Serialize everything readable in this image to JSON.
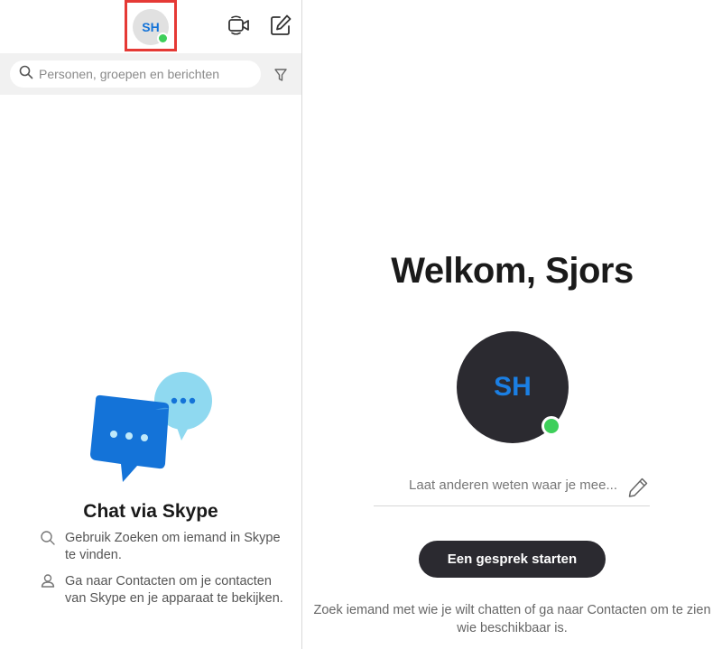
{
  "header": {
    "avatar_initials": "SH",
    "video_icon": "video-call-icon",
    "compose_icon": "new-chat-icon"
  },
  "search": {
    "placeholder": "Personen, groepen en berichten",
    "filter_icon": "filter-icon"
  },
  "promo": {
    "title": "Chat via Skype",
    "tips": [
      {
        "icon": "search-icon",
        "text": "Gebruik Zoeken om iemand in Skype te vinden."
      },
      {
        "icon": "person-icon",
        "text": "Ga naar Contacten om je contacten van Skype en je apparaat te bekijken."
      }
    ]
  },
  "main": {
    "welcome": "Welkom, Sjors",
    "avatar_initials": "SH",
    "mood_placeholder": "Laat anderen weten waar je mee...",
    "start_button": "Een gesprek starten",
    "hint": "Zoek iemand met wie je wilt chatten of ga naar Contacten om te zien wie beschikbaar is."
  },
  "colors": {
    "accent": "#1473d8",
    "presence": "#3ecf5a",
    "highlight": "#e53935",
    "dark": "#2b2a30"
  }
}
